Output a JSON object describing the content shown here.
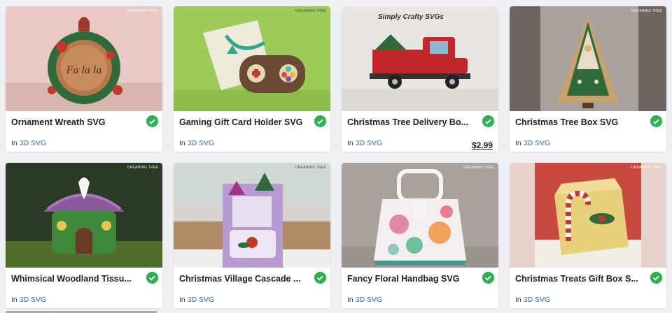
{
  "brand_text": "DREAMING TREE",
  "products": [
    {
      "title": "Ornament Wreath SVG",
      "category_prefix": "In",
      "category": "3D SVG",
      "price": "",
      "icon": "ornament-wreath-image"
    },
    {
      "title": "Gaming Gift Card Holder SVG",
      "category_prefix": "In",
      "category": "3D SVG",
      "price": "",
      "icon": "gaming-card-holder-image"
    },
    {
      "title": "Christmas Tree Delivery Bo...",
      "category_prefix": "In",
      "category": "3D SVG",
      "price": "$2.99",
      "icon": "red-truck-image",
      "overlay_text": "Simply Crafty SVGs"
    },
    {
      "title": "Christmas Tree Box SVG",
      "category_prefix": "In",
      "category": "3D SVG",
      "price": "",
      "icon": "tree-box-image"
    },
    {
      "title": "Whimsical Woodland Tissu...",
      "category_prefix": "In",
      "category": "3D SVG",
      "price": "",
      "icon": "woodland-tissue-house-image"
    },
    {
      "title": "Christmas Village Cascade ...",
      "category_prefix": "In",
      "category": "3D SVG",
      "price": "",
      "icon": "village-cascade-card-image"
    },
    {
      "title": "Fancy Floral Handbag SVG",
      "category_prefix": "In",
      "category": "3D SVG",
      "price": "",
      "icon": "floral-handbag-image"
    },
    {
      "title": "Christmas Treats Gift Box S...",
      "category_prefix": "In",
      "category": "3D SVG",
      "price": "",
      "icon": "treats-gift-box-image"
    }
  ],
  "colors": {
    "check": "#2bb24c",
    "link": "#2a6fad",
    "background": "#eef0f4"
  }
}
